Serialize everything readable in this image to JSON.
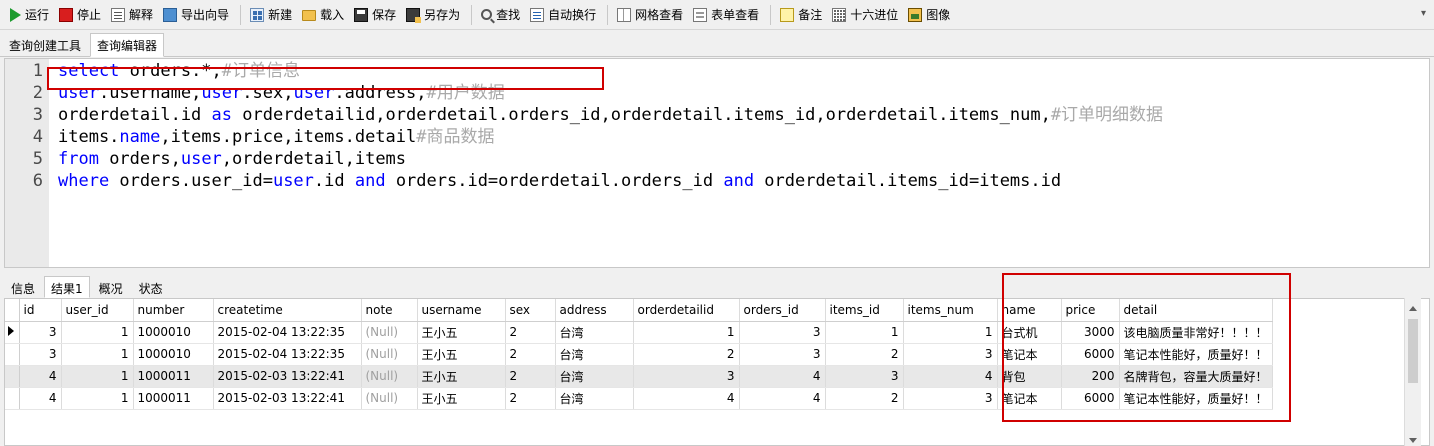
{
  "toolbar": {
    "run": "运行",
    "stop": "停止",
    "explain": "解释",
    "export_wizard": "导出向导",
    "new": "新建",
    "load": "载入",
    "save": "保存",
    "save_as": "另存为",
    "find": "查找",
    "word_wrap": "自动换行",
    "grid_view": "网格查看",
    "form_view": "表单查看",
    "memo": "备注",
    "hex": "十六进位",
    "image": "图像"
  },
  "editor_tabs": [
    "查询创建工具",
    "查询编辑器"
  ],
  "editor": {
    "lines": [
      {
        "num": "1",
        "tokens": [
          [
            "kw",
            "select"
          ],
          [
            "id",
            " orders.*,"
          ],
          [
            "cm",
            "#订单信息"
          ]
        ]
      },
      {
        "num": "2",
        "tokens": [
          [
            "kw",
            "user"
          ],
          [
            "id",
            ".username,"
          ],
          [
            "kw",
            "user"
          ],
          [
            "id",
            ".sex,"
          ],
          [
            "kw",
            "user"
          ],
          [
            "id",
            ".address,"
          ],
          [
            "cm",
            "#用户数据"
          ]
        ]
      },
      {
        "num": "3",
        "tokens": [
          [
            "id",
            "orderdetail.id "
          ],
          [
            "kw",
            "as"
          ],
          [
            "id",
            " orderdetailid,orderdetail.orders_id,orderdetail.items_id,orderdetail.items_num,"
          ],
          [
            "cm",
            "#订单明细数据"
          ]
        ]
      },
      {
        "num": "4",
        "tokens": [
          [
            "id",
            "items."
          ],
          [
            "kw",
            "name"
          ],
          [
            "id",
            ",items.price,items.detail"
          ],
          [
            "cm",
            "#商品数据"
          ]
        ]
      },
      {
        "num": "5",
        "tokens": [
          [
            "kw",
            "from"
          ],
          [
            "id",
            " orders,"
          ],
          [
            "kw",
            "user"
          ],
          [
            "id",
            ",orderdetail,items"
          ]
        ]
      },
      {
        "num": "6",
        "tokens": [
          [
            "kw",
            "where"
          ],
          [
            "id",
            " orders.user_id="
          ],
          [
            "kw",
            "user"
          ],
          [
            "id",
            ".id "
          ],
          [
            "kw",
            "and"
          ],
          [
            "id",
            " orders.id=orderdetail.orders_id "
          ],
          [
            "kw",
            "and"
          ],
          [
            "id",
            " orderdetail.items_id=items.id"
          ]
        ]
      }
    ]
  },
  "result_tabs": [
    "信息",
    "结果1",
    "概况",
    "状态"
  ],
  "grid": {
    "columns": [
      "id",
      "user_id",
      "number",
      "createtime",
      "note",
      "username",
      "sex",
      "address",
      "orderdetailid",
      "orders_id",
      "items_id",
      "items_num",
      "name",
      "price",
      "detail"
    ],
    "rows": [
      [
        "3",
        "1",
        "1000010",
        "2015-02-04 13:22:35",
        "(Null)",
        "王小五",
        "2",
        "台湾",
        "1",
        "3",
        "1",
        "1",
        "台式机",
        "3000",
        "该电脑质量非常好！！！！"
      ],
      [
        "3",
        "1",
        "1000010",
        "2015-02-04 13:22:35",
        "(Null)",
        "王小五",
        "2",
        "台湾",
        "2",
        "3",
        "2",
        "3",
        "笔记本",
        "6000",
        "笔记本性能好，质量好！！"
      ],
      [
        "4",
        "1",
        "1000011",
        "2015-02-03 13:22:41",
        "(Null)",
        "王小五",
        "2",
        "台湾",
        "3",
        "4",
        "3",
        "4",
        "背包",
        "200",
        "名牌背包，容量大质量好！"
      ],
      [
        "4",
        "1",
        "1000011",
        "2015-02-03 13:22:41",
        "(Null)",
        "王小五",
        "2",
        "台湾",
        "4",
        "4",
        "2",
        "3",
        "笔记本",
        "6000",
        "笔记本性能好，质量好！！"
      ]
    ]
  },
  "colors": {
    "keyword": "#0000ff",
    "comment": "#a9a9a9",
    "highlight_box": "#d00000"
  }
}
